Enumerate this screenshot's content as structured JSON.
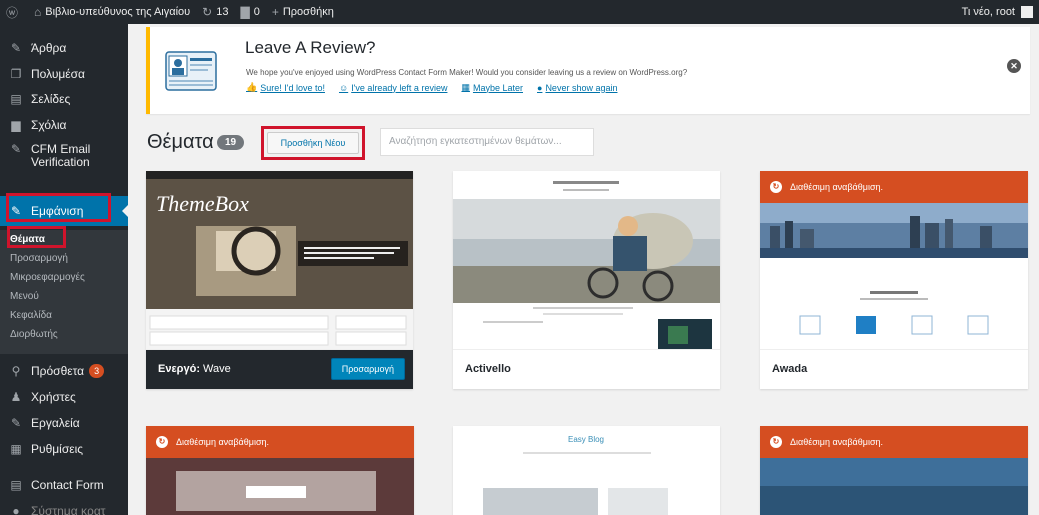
{
  "adminbar": {
    "site_name": "Βιβλιο-υπεύθυνος της Αιγαίου",
    "comments_count": "13",
    "updates_count": "0",
    "new_label": "Προσθήκη",
    "greeting": "Τι νέο, root"
  },
  "sidebar": {
    "items": [
      {
        "label": "Άρθρα",
        "icon": "pin-icon"
      },
      {
        "label": "Πολυμέσα",
        "icon": "media-icon"
      },
      {
        "label": "Σελίδες",
        "icon": "pages-icon"
      },
      {
        "label": "Σχόλια",
        "icon": "comments-icon"
      },
      {
        "label": "CFM Email Verification",
        "icon": "email-icon"
      },
      {
        "label": "Εμφάνιση",
        "icon": "brush-icon"
      },
      {
        "label": "Πρόσθετα",
        "icon": "plugin-icon",
        "badge": "3"
      },
      {
        "label": "Χρήστες",
        "icon": "users-icon"
      },
      {
        "label": "Εργαλεία",
        "icon": "tools-icon"
      },
      {
        "label": "Ρυθμίσεις",
        "icon": "settings-icon"
      },
      {
        "label": "Contact Form",
        "icon": "form-icon"
      },
      {
        "label": "Σύστημα κρατ",
        "icon": "circle-icon"
      }
    ],
    "submenu": [
      "Θέματα",
      "Προσαρμογή",
      "Μικροεφαρμογές",
      "Μενού",
      "Κεφαλίδα",
      "Διορθωτής"
    ]
  },
  "notice": {
    "title": "Leave A Review?",
    "text": "We hope you've enjoyed using WordPress Contact Form Maker! Would you consider leaving us a review on WordPress.org?",
    "links": [
      "Sure! I'd love to!",
      "I've already left a review",
      "Maybe Later",
      "Never show again"
    ]
  },
  "header": {
    "title": "Θέματα",
    "count": "19",
    "add_new": "Προσθήκη Νέου",
    "search_placeholder": "Αναζήτηση εγκατεστημένων θεμάτων..."
  },
  "themes": [
    {
      "name": "Wave",
      "active_prefix": "Ενεργό:",
      "action": "Προσαρμογή",
      "preview_title": "ThemeBox"
    },
    {
      "name": "Activello"
    },
    {
      "name": "Awada",
      "update": "Διαθέσιμη αναβάθμιση."
    },
    {
      "name": "",
      "update": "Διαθέσιμη αναβάθμιση."
    },
    {
      "name": "",
      "preview_title": "Easy Blog"
    },
    {
      "name": "",
      "update": "Διαθέσιμη αναβάθμιση."
    }
  ],
  "colors": {
    "accent": "#0073aa",
    "highlight": "#d0142c",
    "update": "#d54e21",
    "sidebar": "#23282d"
  }
}
